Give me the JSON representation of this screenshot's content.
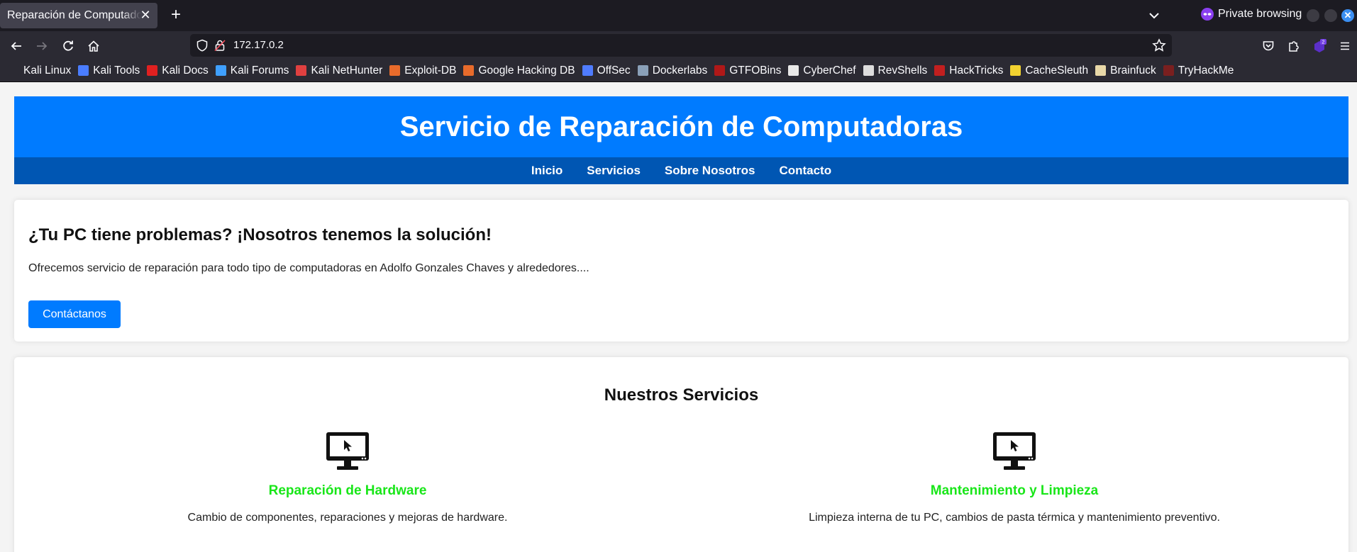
{
  "browser": {
    "tab_title": "Reparación de Computadoras",
    "tab_close": "✕",
    "new_tab": "+",
    "private_label": "Private browsing",
    "url": "172.17.0.2",
    "extensions_badge": "2",
    "bookmarks": [
      {
        "label": "Kali Linux",
        "color": "#2b2a33"
      },
      {
        "label": "Kali Tools",
        "color": "#4a7dff"
      },
      {
        "label": "Kali Docs",
        "color": "#e02020"
      },
      {
        "label": "Kali Forums",
        "color": "#3fa0ff"
      },
      {
        "label": "Kali NetHunter",
        "color": "#e04040"
      },
      {
        "label": "Exploit-DB",
        "color": "#e86b2b"
      },
      {
        "label": "Google Hacking DB",
        "color": "#e86b2b"
      },
      {
        "label": "OffSec",
        "color": "#4f7cff"
      },
      {
        "label": "Dockerlabs",
        "color": "#8aa0b8"
      },
      {
        "label": "GTFOBins",
        "color": "#b01818"
      },
      {
        "label": "CyberChef",
        "color": "#e8e8e8"
      },
      {
        "label": "RevShells",
        "color": "#dddddd"
      },
      {
        "label": "HackTricks",
        "color": "#c21f1f"
      },
      {
        "label": "CacheSleuth",
        "color": "#f2d230"
      },
      {
        "label": "Brainfuck",
        "color": "#e8d8a8"
      },
      {
        "label": "TryHackMe",
        "color": "#7a1f1f"
      }
    ]
  },
  "site": {
    "title": "Servicio de Reparación de Computadoras",
    "nav": [
      "Inicio",
      "Servicios",
      "Sobre Nosotros",
      "Contacto"
    ],
    "hero": {
      "heading": "¿Tu PC tiene problemas? ¡Nosotros tenemos la solución!",
      "text": "Ofrecemos servicio de reparación para todo tipo de computadoras en Adolfo Gonzales Chaves y alrededores....",
      "button": "Contáctanos"
    },
    "services": {
      "heading": "Nuestros Servicios",
      "items": [
        {
          "icon": "computer-icon",
          "title": "Reparación de Hardware",
          "text": "Cambio de componentes, reparaciones y mejoras de hardware."
        },
        {
          "icon": "computer-icon",
          "title": "Mantenimiento y Limpieza",
          "text": "Limpieza interna de tu PC, cambios de pasta térmica y mantenimiento preventivo."
        }
      ]
    }
  },
  "colors": {
    "primary": "#007bff",
    "nav_dark": "#0056b3",
    "service_title": "#19e619"
  }
}
